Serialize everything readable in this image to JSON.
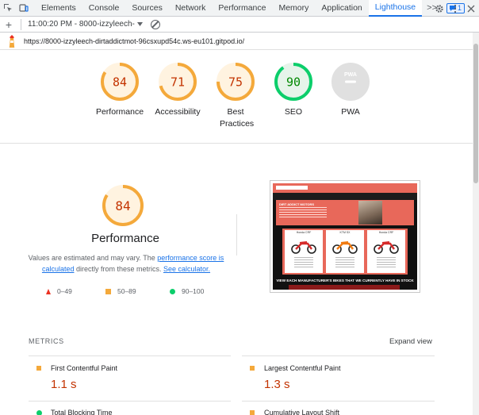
{
  "devtools": {
    "tabs": [
      "Elements",
      "Console",
      "Sources",
      "Network",
      "Performance",
      "Memory",
      "Application",
      "Lighthouse"
    ],
    "active_tab": "Lighthouse",
    "overflow_label": ">>",
    "issues_count": "1"
  },
  "lighthouse_toolbar": {
    "report_select": "11:00:20 PM - 8000-izzyleech-"
  },
  "report": {
    "url": "https://8000-izzyleech-dirtaddictmot-96csxupd54c.ws-eu101.gitpod.io/"
  },
  "summary": [
    {
      "label": "Performance",
      "score": "84",
      "status": "average"
    },
    {
      "label": "Accessibility",
      "score": "71",
      "status": "average"
    },
    {
      "label": "Best Practices",
      "score": "75",
      "status": "average"
    },
    {
      "label": "SEO",
      "score": "90",
      "status": "pass"
    },
    {
      "label": "PWA",
      "score": "",
      "status": "na",
      "badge": "PWA"
    }
  ],
  "performance": {
    "score": "84",
    "title": "Performance",
    "desc_prefix": "Values are estimated and may vary. The ",
    "desc_link1": "performance score is calculated",
    "desc_middle": " directly from these metrics. ",
    "desc_link2": "See calculator."
  },
  "legend": {
    "fail": "0–49",
    "average": "50–89",
    "pass": "90–100"
  },
  "screenshot": {
    "hero_title": "DIRT ADDICT MOTORS",
    "bikes": [
      "Honda CRF",
      "KTM SX",
      "Honda CRF"
    ],
    "banner": "VIEW EACH MANUFACTURER'S BIKES THAT WE CURRENTLY HAVE IN STOCK"
  },
  "metrics": {
    "heading": "METRICS",
    "expand_label": "Expand view",
    "items": [
      {
        "name": "First Contentful Paint",
        "value": "1.1 s",
        "status": "average"
      },
      {
        "name": "Largest Contentful Paint",
        "value": "1.3 s",
        "status": "average"
      },
      {
        "name": "Total Blocking Time",
        "value": "",
        "status": "pass"
      },
      {
        "name": "Cumulative Layout Shift",
        "value": "",
        "status": "average"
      }
    ]
  },
  "colors": {
    "average": "#f4a93b",
    "average_text": "#c33300",
    "average_fill": "#fff3e0",
    "pass": "#0cce6b",
    "pass_text": "#008800",
    "pass_fill": "#e6f4ea",
    "fail": "#eb3223",
    "na": "#e0e0e0",
    "link": "#1a73e8"
  }
}
